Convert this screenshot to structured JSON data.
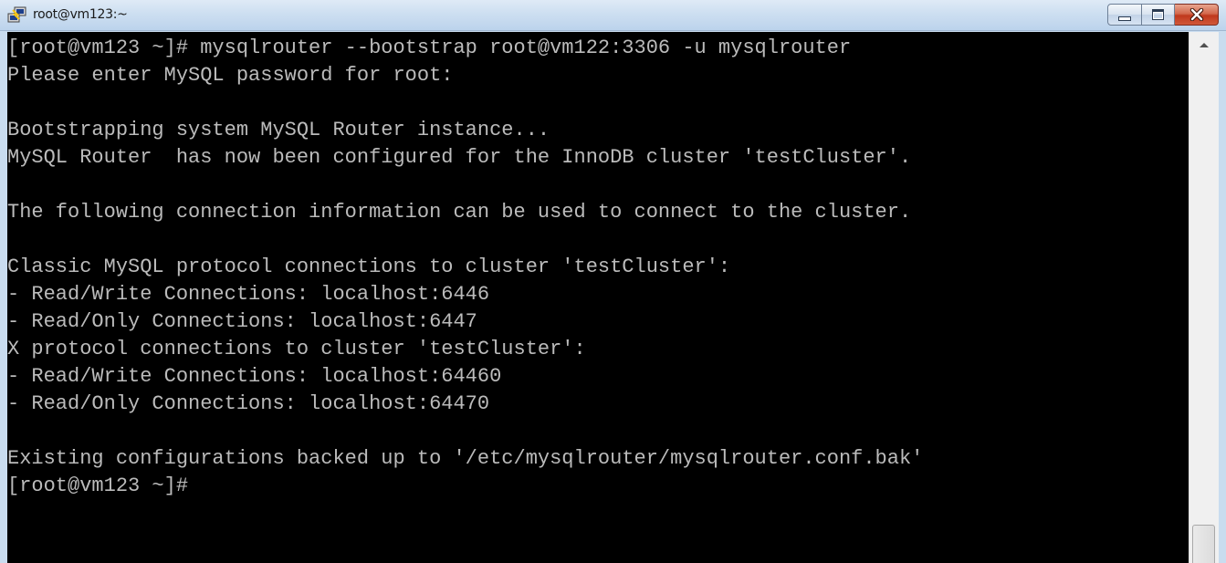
{
  "window": {
    "title": "root@vm123:~",
    "icon": "putty-terminal-icon",
    "controls": {
      "minimize": "minimize-icon",
      "maximize": "maximize-icon",
      "close": "close-icon"
    }
  },
  "terminal": {
    "colors": {
      "background": "#000000",
      "text": "#bbbbbb"
    },
    "lines": [
      "[root@vm123 ~]# mysqlrouter --bootstrap root@vm122:3306 -u mysqlrouter",
      "Please enter MySQL password for root:",
      "",
      "Bootstrapping system MySQL Router instance...",
      "MySQL Router  has now been configured for the InnoDB cluster 'testCluster'.",
      "",
      "The following connection information can be used to connect to the cluster.",
      "",
      "Classic MySQL protocol connections to cluster 'testCluster':",
      "- Read/Write Connections: localhost:6446",
      "- Read/Only Connections: localhost:6447",
      "X protocol connections to cluster 'testCluster':",
      "- Read/Write Connections: localhost:64460",
      "- Read/Only Connections: localhost:64470",
      "",
      "Existing configurations backed up to '/etc/mysqlrouter/mysqlrouter.conf.bak'",
      "[root@vm123 ~]#"
    ]
  },
  "scrollbar": {
    "up_icon": "scroll-up-arrow-icon",
    "position": 1.0
  }
}
